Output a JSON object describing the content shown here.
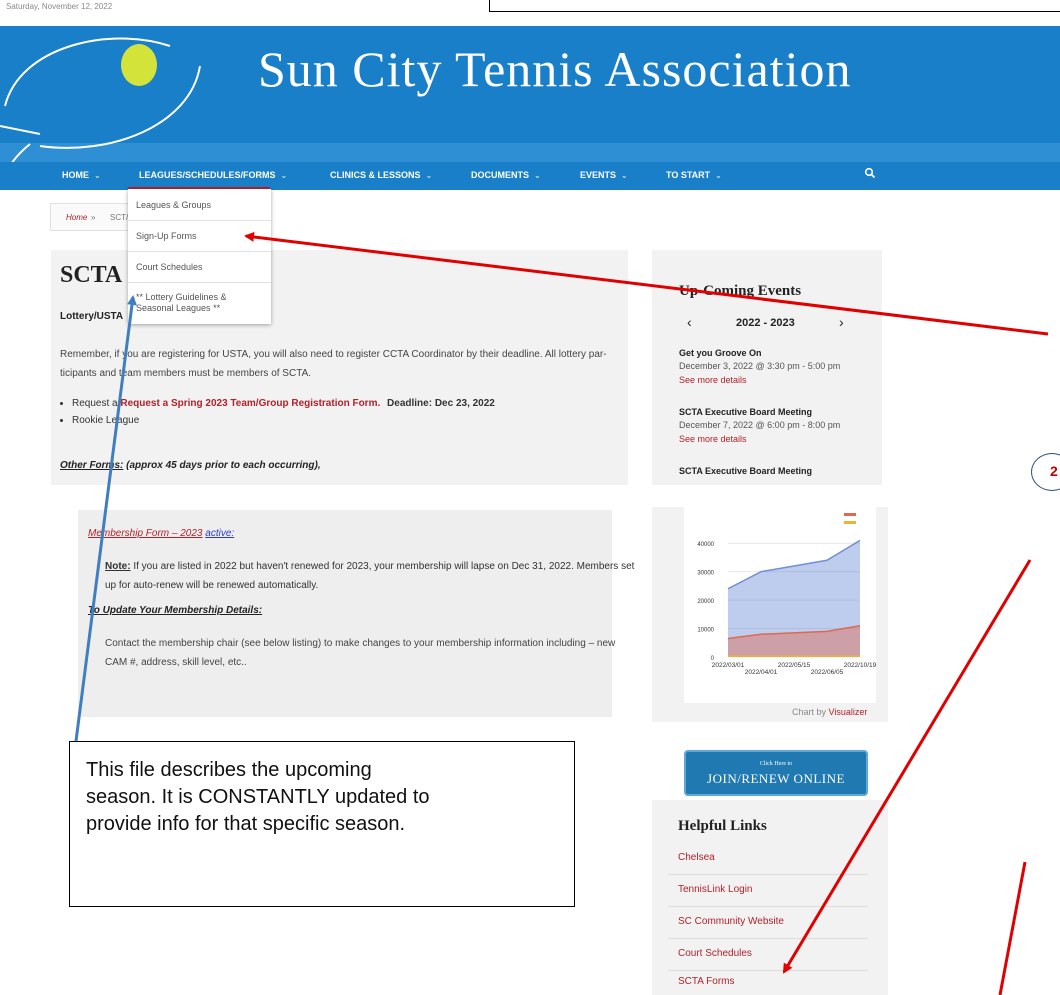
{
  "date_text": "Saturday, November 12, 2022",
  "site_title": "Sun City Tennis Association",
  "nav": {
    "items": [
      {
        "label": "HOME",
        "chevron": "⌄"
      },
      {
        "label": "LEAGUES/SCHEDULES/FORMS",
        "chevron": "⌄"
      },
      {
        "label": "CLINICS & LESSONS",
        "chevron": "⌄"
      },
      {
        "label": "DOCUMENTS",
        "chevron": "⌄"
      },
      {
        "label": "EVENTS",
        "chevron": "⌄"
      },
      {
        "label": "TO START",
        "chevron": "⌄"
      }
    ],
    "search_icon": "search-icon"
  },
  "dropdown": {
    "items": [
      "Leagues & Groups",
      "Sign-Up Forms",
      "Court Schedules",
      "** Lottery Guidelines &",
      "Seasonal Leagues **"
    ]
  },
  "breadcrumb": {
    "home": "Home",
    "sep": "»",
    "current": "SCT/"
  },
  "main": {
    "title": "SCTA",
    "lottery_label": "Lottery/USTA",
    "para1_line1": "Remember, if you are registering for USTA, you will also need to register CCTA Coordinator by their deadline. All lottery par-",
    "para1_line2": "ticipants and team members must be members of SCTA.",
    "bullet1_prefix": "Request a",
    "bullet1_link": "Request a Spring 2023 Team/Group Registration Form.",
    "bullet1_deadline": "Deadline: Dec 23, 2022",
    "bullet2": "Rookie League",
    "other_forms_link": "Other Forms:",
    "other_forms_rest": "(approx 45 days prior to each occurring),"
  },
  "membership": {
    "form_link": "Membership Form – 2023",
    "active_link": "active:",
    "note_label": "Note:",
    "note_text_line1": "If you are listed in 2022 but haven't renewed for 2023, your membership will lapse on Dec 31, 2022. Members set",
    "note_text_line2": "up for auto-renew will be renewed automatically.",
    "update_heading": "To Update Your Membership Details:",
    "contact_line1": "Contact the membership chair (see below listing) to make changes to your membership information including – new",
    "contact_line2": "CAM #, address, skill level, etc.."
  },
  "events": {
    "title": "Up-Coming Events",
    "prev": "‹",
    "next": "›",
    "year": "2022 - 2023",
    "items": [
      {
        "title": "Get you Groove On",
        "date": "December 3, 2022 @ 3:30 pm - 5:00 pm",
        "more": "See more details"
      },
      {
        "title": "SCTA Executive Board Meeting",
        "date": "December 7, 2022 @ 6:00 pm - 8:00 pm",
        "more": "See more details"
      },
      {
        "title": "SCTA Executive Board Meeting",
        "date": "",
        "more": ""
      }
    ]
  },
  "chart_data": {
    "type": "area",
    "x": [
      "2022/03/01",
      "2022/04/01",
      "2022/05/15",
      "2022/06/05",
      "2022/10/19"
    ],
    "xtick_labels_row1": [
      "2022/03/01",
      "2022/05/15",
      "2022/10/19"
    ],
    "xtick_labels_row2": [
      "2022/04/01",
      "2022/06/05"
    ],
    "yticks": [
      "40000",
      "30000",
      "20000",
      "10000",
      "0"
    ],
    "ylim": [
      0,
      45000
    ],
    "series": [
      {
        "values": [
          24000,
          30000,
          32000,
          34000,
          41000
        ],
        "color": "#6f8fd8"
      },
      {
        "values": [
          6500,
          8000,
          8500,
          9000,
          11000
        ],
        "color": "#e0684f"
      },
      {
        "values": [
          300,
          300,
          300,
          300,
          300
        ],
        "color": "#e8b43a"
      }
    ],
    "legend_colors": [
      "#e0684f",
      "#e8b43a"
    ],
    "legend": "top-right",
    "credit_prefix": "Chart by",
    "credit_link": "Visualizer"
  },
  "join": {
    "small": "Click Here to",
    "big": "JOIN/RENEW ONLINE"
  },
  "helpful_links": {
    "title": "Helpful Links",
    "items": [
      "Chelsea",
      "TennisLink Login",
      "SC Community Website",
      "Court Schedules",
      "SCTA Forms"
    ]
  },
  "annotation": {
    "note_line1": "This file describes the upcoming",
    "note_line2": "season.  It is CONSTANTLY updated to",
    "note_line3": "provide info for that specific season.",
    "step_number": "2",
    "arrow_colors": {
      "red": "#e00000",
      "blue": "#3f7fc0"
    }
  }
}
